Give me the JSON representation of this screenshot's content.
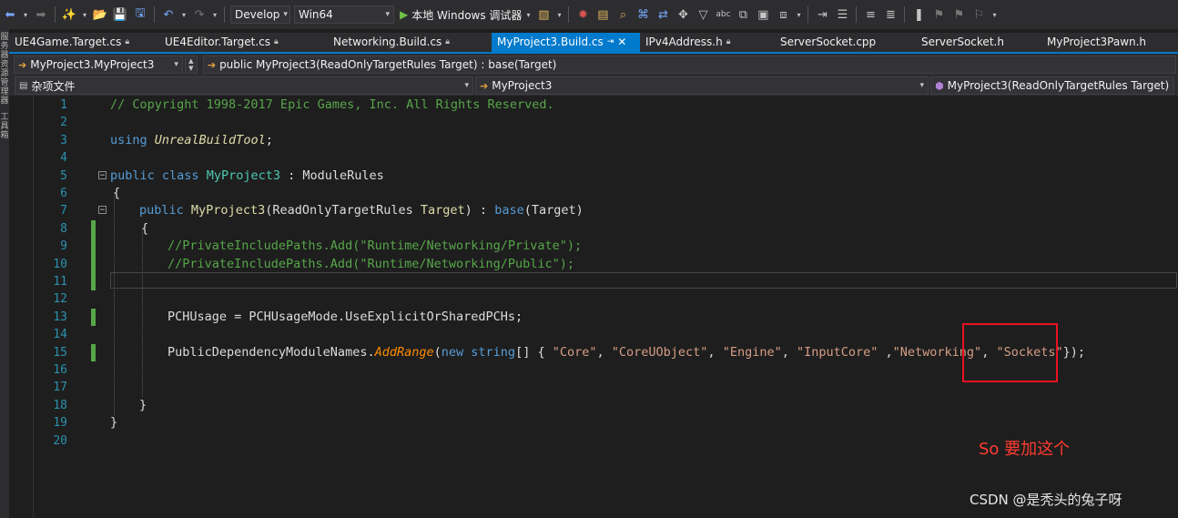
{
  "toolbar": {
    "config": "Develop",
    "platform": "Win64",
    "run_label": "本地 Windows 调试器"
  },
  "sidebar": {
    "labels": [
      "服务器资源管理器",
      "工具箱"
    ]
  },
  "tabs": [
    {
      "label": "UE4Game.Target.cs",
      "pinned": true
    },
    {
      "label": "UE4Editor.Target.cs",
      "pinned": true
    },
    {
      "label": "Networking.Build.cs",
      "pinned": true
    },
    {
      "label": "MyProject3.Build.cs",
      "pinned": true,
      "active": true
    },
    {
      "label": "IPv4Address.h",
      "pinned": true
    },
    {
      "label": "ServerSocket.cpp",
      "pinned": false
    },
    {
      "label": "ServerSocket.h",
      "pinned": false
    },
    {
      "label": "MyProject3Pawn.h",
      "pinned": false
    }
  ],
  "nav": {
    "class_combo": "MyProject3.MyProject3",
    "member_combo": "public MyProject3(ReadOnlyTargetRules Target) : base(Target)",
    "file_combo": "杂项文件",
    "scope_combo": "MyProject3",
    "symbol_combo": "MyProject3(ReadOnlyTargetRules Target)"
  },
  "editor": {
    "line_numbers": [
      "1",
      "2",
      "3",
      "4",
      "5",
      "6",
      "7",
      "8",
      "9",
      "10",
      "11",
      "12",
      "13",
      "14",
      "15",
      "16",
      "17",
      "18",
      "19",
      "20"
    ],
    "lines": {
      "l1": {
        "comment": "// Copyright 1998-2017 Epic Games, Inc. All Rights Reserved."
      },
      "l3": {
        "kw": "using",
        "ns": "UnrealBuildTool",
        "semi": ";"
      },
      "l5": {
        "kw1": "public",
        "kw2": "class",
        "cls": "MyProject3",
        "rest": " : ModuleRules"
      },
      "l6": {
        "brace": "{"
      },
      "l7": {
        "kw": "public",
        "ctor": "MyProject3",
        "p1": "(ReadOnlyTargetRules ",
        "param": "Target",
        "p2": ") : ",
        "base": "base",
        "p3": "(Target)"
      },
      "l8": {
        "brace": "{"
      },
      "l9": {
        "comment": "//PrivateIncludePaths.Add(\"Runtime/Networking/Private\");"
      },
      "l10": {
        "comment": "//PrivateIncludePaths.Add(\"Runtime/Networking/Public\");"
      },
      "l13": {
        "a": "PCHUsage = PCHUsageMode.",
        "m": "UseExplicitOrSharedPCHs",
        "b": ";"
      },
      "l15": {
        "a": "PublicDependencyModuleNames.",
        "m": "AddRange",
        "b": "(",
        "kw1": "new",
        "kw2": "string",
        "c": "[] { ",
        "s1": "\"Core\"",
        "s2": "\"CoreUObject\"",
        "s3": "\"Engine\"",
        "s4": "\"InputCore\"",
        "s5": "\"Networking\"",
        "s6": "\"Sockets\"",
        "end": "});"
      },
      "l18": {
        "brace": "}"
      },
      "l19": {
        "brace": "}"
      }
    }
  },
  "annotation": {
    "text": "So 要加这个",
    "color": "#ff3b30"
  },
  "watermark": "CSDN @是秃头的兔子呀",
  "colors": {
    "accent": "#007acc",
    "comment": "#57a64a",
    "keyword": "#569cd6",
    "type": "#4ec9b0",
    "string": "#d69d85",
    "highlight_box": "#e81123"
  }
}
